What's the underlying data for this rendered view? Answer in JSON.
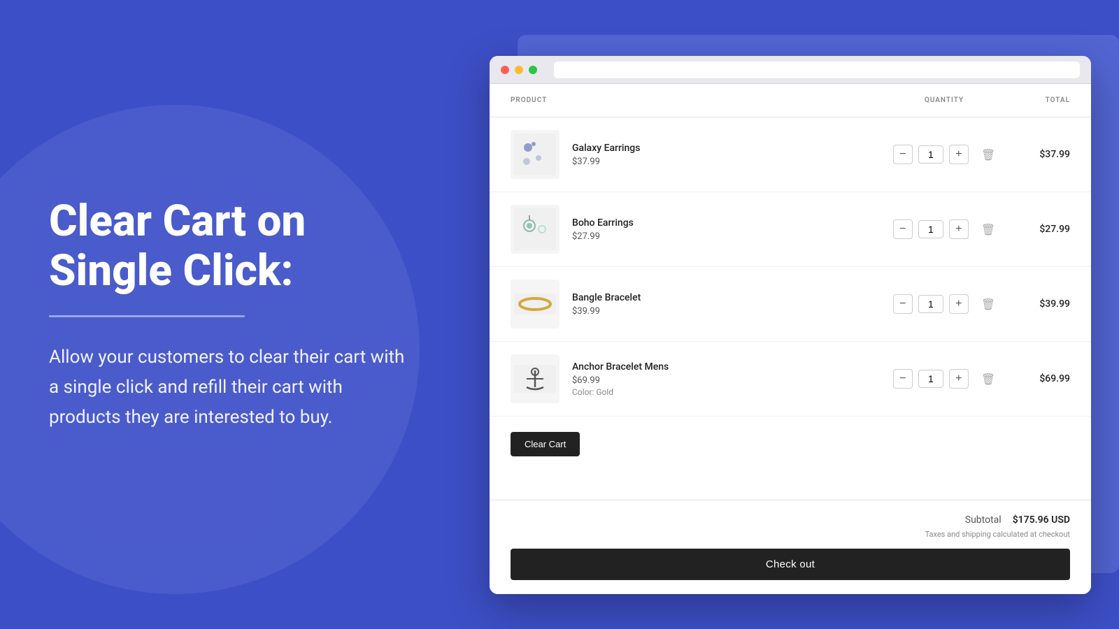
{
  "background": {
    "color": "#3d4fc7"
  },
  "left": {
    "headline": "Clear Cart on Single Click:",
    "divider": true,
    "description": "Allow your customers to clear their cart with a single click and refill their cart with products they are interested to buy."
  },
  "browser": {
    "dots": [
      "red",
      "yellow",
      "green"
    ],
    "header": {
      "product_label": "PRODUCT",
      "quantity_label": "QUANTITY",
      "total_label": "TOTAL"
    },
    "items": [
      {
        "name": "Galaxy Earrings",
        "price": "$37.99",
        "variant": null,
        "qty": 1,
        "total": "$37.99",
        "image_type": "galaxy"
      },
      {
        "name": "Boho Earrings",
        "price": "$27.99",
        "variant": null,
        "qty": 1,
        "total": "$27.99",
        "image_type": "boho"
      },
      {
        "name": "Bangle Bracelet",
        "price": "$39.99",
        "variant": null,
        "qty": 1,
        "total": "$39.99",
        "image_type": "bangle"
      },
      {
        "name": "Anchor Bracelet Mens",
        "price": "$69.99",
        "variant": "Color: Gold",
        "qty": 1,
        "total": "$69.99",
        "image_type": "anchor"
      }
    ],
    "clear_cart_label": "Clear Cart",
    "subtotal_label": "Subtotal",
    "subtotal_value": "$175.96 USD",
    "tax_note": "Taxes and shipping calculated at checkout",
    "checkout_label": "Check out"
  }
}
